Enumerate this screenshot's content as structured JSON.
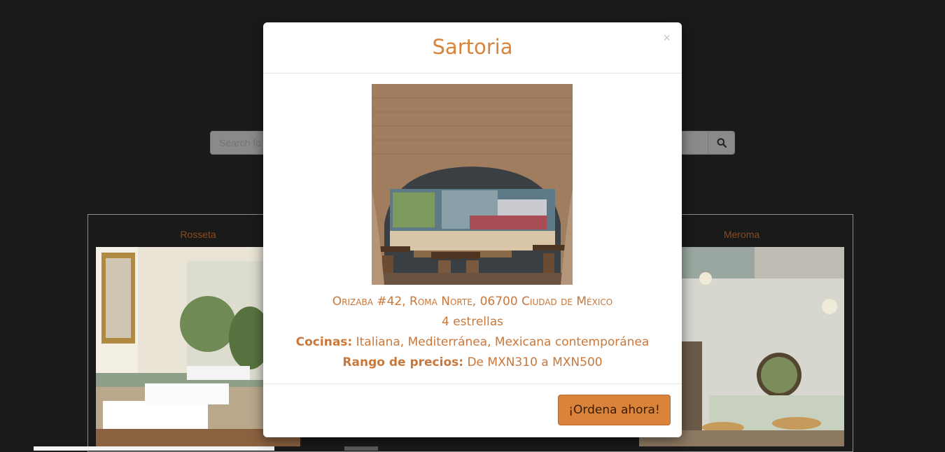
{
  "search": {
    "placeholder": "Search fo"
  },
  "cards": [
    {
      "title": "Rosseta"
    },
    {
      "title": "Meroma"
    }
  ],
  "modal": {
    "title": "Sartoria",
    "close_label": "×",
    "address": "Orizaba #42, Roma Norte, 06700 Ciudad de México",
    "rating": "4 estrellas",
    "cuisines_label": "Cocinas:",
    "cuisines_value": " Italiana, Mediterránea, Mexicana contemporánea",
    "price_label": "Rango de precios:",
    "price_value": " De MXN310 a MXN500",
    "order_button": "¡Ordena ahora!"
  },
  "colors": {
    "accent": "#d9843a",
    "card_title": "#8a4a1c",
    "background": "#1b1a1a"
  },
  "icons": {
    "search": "search-icon",
    "close": "close-icon"
  }
}
